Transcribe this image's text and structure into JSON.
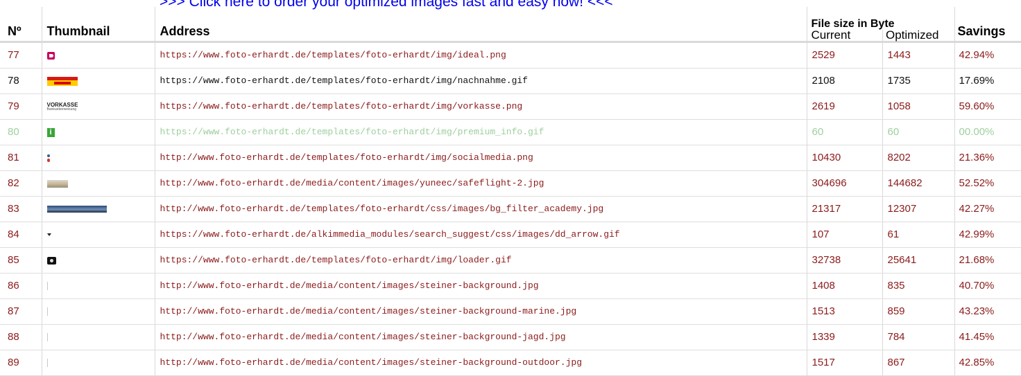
{
  "banner": {
    "text": ">>> Click here to order your optimized images fast and easy now! <<<"
  },
  "table": {
    "headers": {
      "no": "Nº",
      "thumbnail": "Thumbnail",
      "address": "Address",
      "file_size": "File size in Byte",
      "current": "Current",
      "optimized": "Optimized",
      "savings": "Savings"
    },
    "rows": [
      {
        "no": "77",
        "thumb": "ideal-logo-icon",
        "address": "https://www.foto-erhardt.de/templates/foto-erhardt/img/ideal.png",
        "current": "2529",
        "optimized": "1443",
        "savings": "42.94%",
        "style": "red"
      },
      {
        "no": "78",
        "thumb": "dhl-nachnahme-logo-icon",
        "address": "https://www.foto-erhardt.de/templates/foto-erhardt/img/nachnahme.gif",
        "current": "2108",
        "optimized": "1735",
        "savings": "17.69%",
        "style": "black"
      },
      {
        "no": "79",
        "thumb": "vorkasse-logo-icon",
        "thumb_text": "VORKASSE",
        "thumb_sub": "Bankueberweisung",
        "address": "https://www.foto-erhardt.de/templates/foto-erhardt/img/vorkasse.png",
        "current": "2619",
        "optimized": "1058",
        "savings": "59.60%",
        "style": "red"
      },
      {
        "no": "80",
        "thumb": "info-icon",
        "thumb_text": "i",
        "address": "https://www.foto-erhardt.de/templates/foto-erhardt/img/premium_info.gif",
        "current": "60",
        "optimized": "60",
        "savings": "00.00%",
        "style": "faded"
      },
      {
        "no": "81",
        "thumb": "social-media-icon",
        "address": "http://www.foto-erhardt.de/templates/foto-erhardt/img/socialmedia.png",
        "current": "10430",
        "optimized": "8202",
        "savings": "21.36%",
        "style": "red"
      },
      {
        "no": "82",
        "thumb": "landscape-thumbnail-icon",
        "address": "http://www.foto-erhardt.de/media/content/images/yuneec/safeflight-2.jpg",
        "current": "304696",
        "optimized": "144682",
        "savings": "52.52%",
        "style": "red"
      },
      {
        "no": "83",
        "thumb": "lake-banner-thumbnail-icon",
        "address": "http://www.foto-erhardt.de/templates/foto-erhardt/css/images/bg_filter_academy.jpg",
        "current": "21317",
        "optimized": "12307",
        "savings": "42.27%",
        "style": "red"
      },
      {
        "no": "84",
        "thumb": "dropdown-arrow-icon",
        "address": "https://www.foto-erhardt.de/alkimmedia_modules/search_suggest/css/images/dd_arrow.gif",
        "current": "107",
        "optimized": "61",
        "savings": "42.99%",
        "style": "red"
      },
      {
        "no": "85",
        "thumb": "camera-loader-icon",
        "address": "https://www.foto-erhardt.de/templates/foto-erhardt/img/loader.gif",
        "current": "32738",
        "optimized": "25641",
        "savings": "21.68%",
        "style": "red"
      },
      {
        "no": "86",
        "thumb": "thin-background-thumbnail-icon",
        "address": "http://www.foto-erhardt.de/media/content/images/steiner-background.jpg",
        "current": "1408",
        "optimized": "835",
        "savings": "40.70%",
        "style": "red"
      },
      {
        "no": "87",
        "thumb": "thin-background-thumbnail-icon",
        "address": "http://www.foto-erhardt.de/media/content/images/steiner-background-marine.jpg",
        "current": "1513",
        "optimized": "859",
        "savings": "43.23%",
        "style": "red"
      },
      {
        "no": "88",
        "thumb": "thin-background-thumbnail-icon",
        "address": "http://www.foto-erhardt.de/media/content/images/steiner-background-jagd.jpg",
        "current": "1339",
        "optimized": "784",
        "savings": "41.45%",
        "style": "red"
      },
      {
        "no": "89",
        "thumb": "thin-background-thumbnail-icon",
        "address": "http://www.foto-erhardt.de/media/content/images/steiner-background-outdoor.jpg",
        "current": "1517",
        "optimized": "867",
        "savings": "42.85%",
        "style": "red"
      }
    ]
  },
  "colors": {
    "link": "#0000ee",
    "row_red": "#8b1a1a",
    "row_black": "#111111",
    "row_faded": "#9ecf9e"
  }
}
